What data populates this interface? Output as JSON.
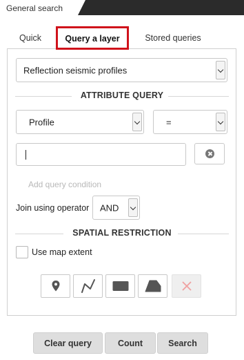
{
  "window": {
    "title": "General search"
  },
  "tabs": [
    {
      "label": "Quick",
      "active": false
    },
    {
      "label": "Query a layer",
      "active": true
    },
    {
      "label": "Stored queries",
      "active": false
    }
  ],
  "layer_select": {
    "value": "Reflection seismic profiles"
  },
  "attribute_query": {
    "title": "ATTRIBUTE QUERY",
    "field_select": {
      "value": "Profile"
    },
    "operator_select": {
      "value": "="
    },
    "value_input": {
      "value": "",
      "placeholder": ""
    },
    "clear_icon": "clear-x-circle-icon",
    "add_condition_label": "Add query condition",
    "join_label": "Join using operator",
    "join_select": {
      "value": "AND"
    }
  },
  "spatial_restriction": {
    "title": "SPATIAL RESTRICTION",
    "use_map_extent_label": "Use map extent",
    "use_map_extent_checked": false,
    "tools": [
      {
        "icon": "point-marker-icon",
        "enabled": true
      },
      {
        "icon": "polyline-icon",
        "enabled": true
      },
      {
        "icon": "rectangle-icon",
        "enabled": true
      },
      {
        "icon": "polygon-icon",
        "enabled": true
      },
      {
        "icon": "clear-drawing-x-icon",
        "enabled": false
      }
    ]
  },
  "actions": {
    "clear_query": "Clear query",
    "count": "Count",
    "search": "Search"
  },
  "colors": {
    "header_bar": "#2b2b2b",
    "active_tab_border": "#d0121b",
    "button_bg": "#dedede",
    "disabled_x": "#f0a0a0"
  }
}
